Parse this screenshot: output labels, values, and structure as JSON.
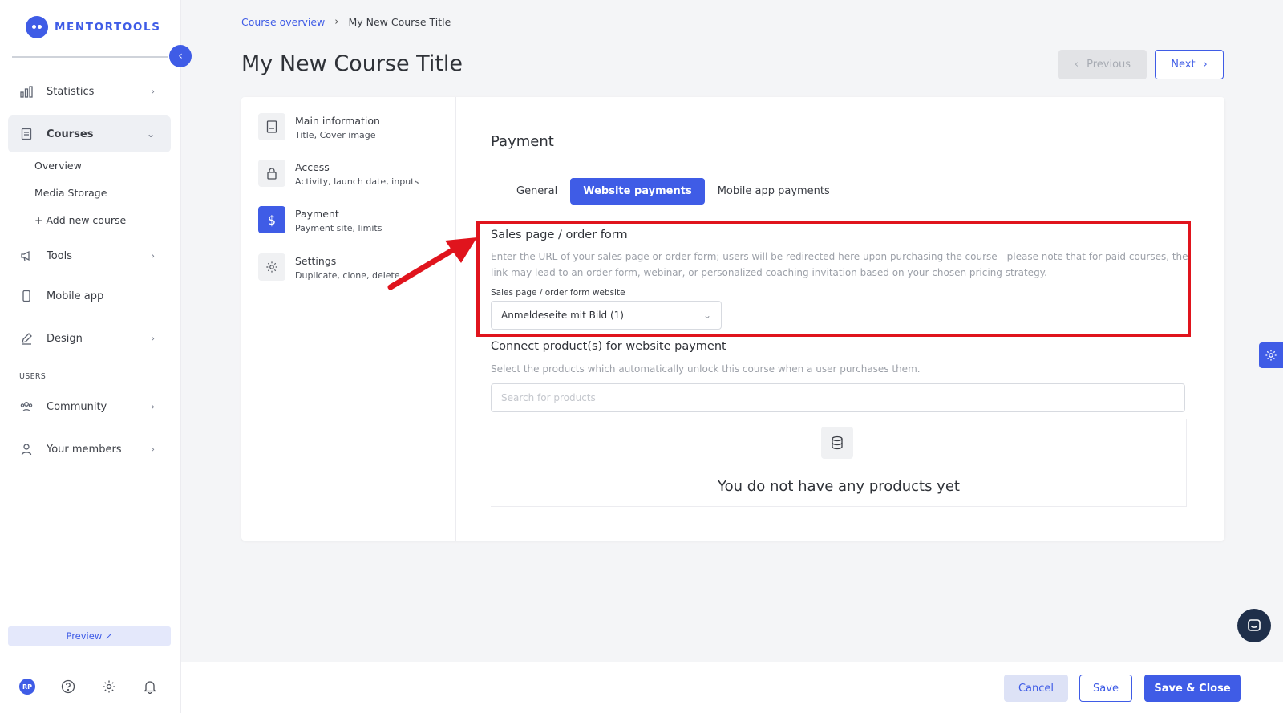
{
  "brand": {
    "name": "MENTORTOOLS"
  },
  "sidebar": {
    "items": [
      {
        "label": "Statistics",
        "icon": "bar-chart-icon"
      },
      {
        "label": "Courses",
        "icon": "book-icon"
      },
      {
        "label": "Tools",
        "icon": "megaphone-icon"
      },
      {
        "label": "Mobile app",
        "icon": "phone-icon"
      },
      {
        "label": "Design",
        "icon": "pencil-icon"
      },
      {
        "label": "Community",
        "icon": "people-icon"
      },
      {
        "label": "Your members",
        "icon": "user-icon"
      }
    ],
    "courses_sub": [
      "Overview",
      "Media Storage",
      "+ Add new course"
    ],
    "section_users": "USERS",
    "preview_label": "Preview ↗",
    "avatar_initials": "RP"
  },
  "breadcrumb": {
    "link": "Course overview",
    "current": "My New Course Title"
  },
  "page_title": "My New Course Title",
  "nav_buttons": {
    "previous": "Previous",
    "next": "Next"
  },
  "steps": [
    {
      "title": "Main information",
      "subtitle": "Title, Cover image"
    },
    {
      "title": "Access",
      "subtitle": "Activity, launch date, inputs"
    },
    {
      "title": "Payment",
      "subtitle": "Payment site, limits"
    },
    {
      "title": "Settings",
      "subtitle": "Duplicate, clone, delete"
    }
  ],
  "payment": {
    "title": "Payment",
    "tabs": [
      "General",
      "Website payments",
      "Mobile app payments"
    ],
    "active_tab": "Website payments",
    "sales_page": {
      "heading": "Sales page / order form",
      "description": "Enter the URL of your sales page or order form; users will be redirected here upon purchasing the course—please note that for paid courses, the link may lead to an order form, webinar, or personalized coaching invitation based on your chosen pricing strategy.",
      "field_label": "Sales page / order form website",
      "selected": "Anmeldeseite mit Bild (1)"
    },
    "products": {
      "heading": "Connect product(s) for website payment",
      "description": "Select the products which automatically unlock this course when a user purchases them.",
      "search_placeholder": "Search for products",
      "empty_text": "You do not have any products yet"
    }
  },
  "footer": {
    "cancel": "Cancel",
    "save": "Save",
    "save_close": "Save & Close"
  },
  "colors": {
    "accent": "#3f5ce6",
    "highlight": "#e0141d"
  }
}
